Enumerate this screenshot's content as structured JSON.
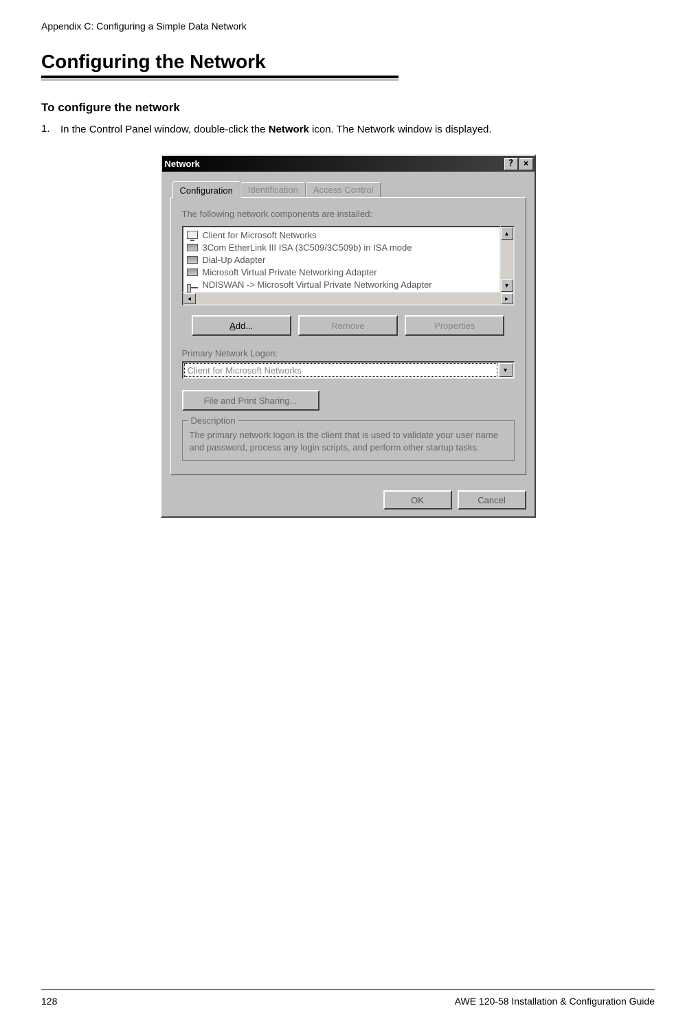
{
  "page": {
    "header": "Appendix C: Configuring a Simple Data Network",
    "section_title": "Configuring the Network",
    "sub_title": "To configure the network",
    "page_number": "128",
    "footer_right": "AWE 120-58 Installation & Configuration Guide"
  },
  "step1": {
    "num": "1.",
    "pre": "In the Control Panel window, double-click the ",
    "bold": "Network",
    "post": " icon. The Network window is displayed."
  },
  "dialog": {
    "title": "Network",
    "tabs": {
      "configuration": "Configuration",
      "identification": "Identification",
      "access": "Access Control"
    },
    "components_label": "The following network components are installed:",
    "list": [
      "Client for Microsoft Networks",
      "3Com EtherLink III ISA (3C509/3C509b) in ISA mode",
      "Dial-Up Adapter",
      "Microsoft Virtual Private Networking Adapter",
      "NDISWAN -> Microsoft Virtual Private Networking Adapter"
    ],
    "buttons": {
      "add": "Add...",
      "remove": "Remove",
      "properties": "Properties"
    },
    "logon_label": "Primary Network Logon:",
    "logon_value": "Client for Microsoft Networks",
    "file_print": "File and Print Sharing...",
    "desc_title": "Description",
    "desc_text": "The primary network logon is the client that is used to validate your user name and password, process any login scripts, and perform other startup tasks.",
    "ok": "OK",
    "cancel": "Cancel"
  }
}
